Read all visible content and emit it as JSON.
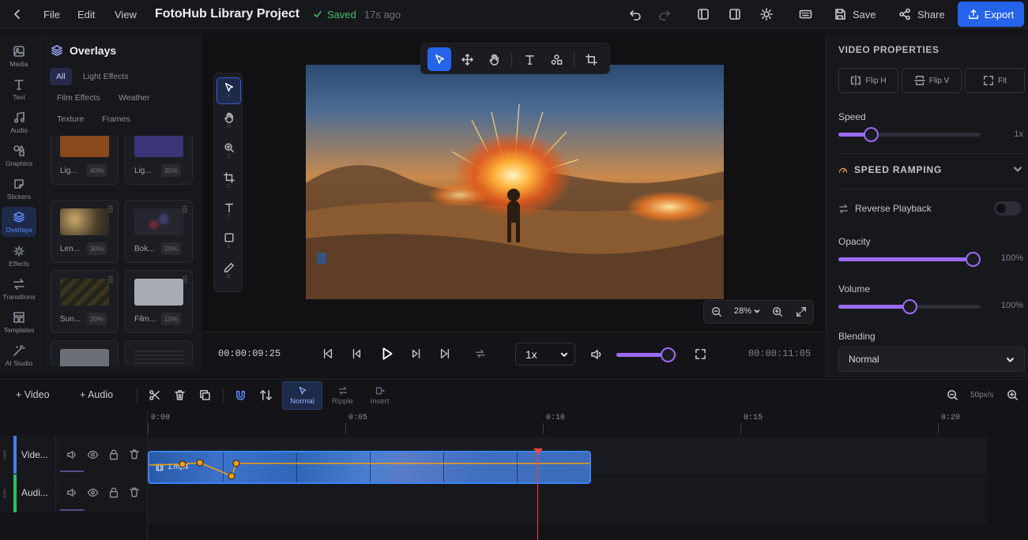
{
  "topbar": {
    "menu": [
      "File",
      "Edit",
      "View"
    ],
    "project_title": "FotoHub Library Project",
    "saved_label": "Saved",
    "saved_time": "17s ago",
    "save_label": "Save",
    "share_label": "Share",
    "export_label": "Export"
  },
  "rail": [
    {
      "label": "Media",
      "icon": "image-icon"
    },
    {
      "label": "Text",
      "icon": "text-icon"
    },
    {
      "label": "Audio",
      "icon": "music-icon"
    },
    {
      "label": "Graphics",
      "icon": "shapes-icon"
    },
    {
      "label": "Stickers",
      "icon": "sticker-icon"
    },
    {
      "label": "Overlays",
      "icon": "layers-icon",
      "active": true
    },
    {
      "label": "Effects",
      "icon": "sparkles-icon"
    },
    {
      "label": "Transitions",
      "icon": "transition-icon"
    },
    {
      "label": "Templates",
      "icon": "template-icon"
    },
    {
      "label": "AI Studio",
      "icon": "wand-icon"
    }
  ],
  "overlays": {
    "title": "Overlays",
    "chips": [
      "All",
      "Light Effects",
      "Film Effects",
      "Weather",
      "Texture",
      "Frames"
    ],
    "cards": [
      {
        "name": "Lig...",
        "pct": "40%",
        "color": "#8a4a1c"
      },
      {
        "name": "Lig...",
        "pct": "35%",
        "color": "#3a3478"
      },
      {
        "name": "Len...",
        "pct": "30%",
        "color": "#6b5a3a"
      },
      {
        "name": "Bok...",
        "pct": "25%",
        "color": "#25262e"
      },
      {
        "name": "Sun...",
        "pct": "20%",
        "color": "#3a3520"
      },
      {
        "name": "Film...",
        "pct": "15%",
        "color": "#a7acb4"
      }
    ]
  },
  "vertical_tools": [
    {
      "icon": "cursor-icon",
      "key": "V"
    },
    {
      "icon": "hand-icon",
      "key": "H"
    },
    {
      "icon": "zoom-icon",
      "key": "Z"
    },
    {
      "icon": "crop-icon",
      "key": "C"
    },
    {
      "icon": "text-tool-icon",
      "key": "T"
    },
    {
      "icon": "square-icon",
      "key": "S"
    },
    {
      "icon": "pen-icon",
      "key": "B"
    }
  ],
  "canvas": {
    "zoom": "28%"
  },
  "playback": {
    "current_time": "00:00:09:25",
    "total_time": "00:00:11:05",
    "speed": "1x",
    "volume": 0.84
  },
  "properties": {
    "title": "VIDEO PROPERTIES",
    "flip_h": "Flip H",
    "flip_v": "Flip V",
    "fit": "Fit",
    "speed_label": "Speed",
    "speed_value": "1x",
    "speed_level": 0.23,
    "speed_ramping": "SPEED RAMPING",
    "reverse_label": "Reverse Playback",
    "opacity_label": "Opacity",
    "opacity_value": "100%",
    "opacity_level": 1.0,
    "volume_label": "Volume",
    "volume_value": "100%",
    "volume_level": 0.5,
    "blending_label": "Blending",
    "blending_value": "Normal"
  },
  "timeline": {
    "add_video": "+ Video",
    "add_audio": "+ Audio",
    "modes": [
      "Normal",
      "Ripple",
      "Insert"
    ],
    "zoom_label": "50px/s",
    "ruler": [
      "0:00",
      "0:05",
      "0:10",
      "0:15",
      "0:20"
    ],
    "tracks": [
      {
        "name": "Vide...",
        "color": "#3b82f6"
      },
      {
        "name": "Audi...",
        "color": "#22c55e"
      }
    ],
    "clip_label": "1.mp4"
  }
}
